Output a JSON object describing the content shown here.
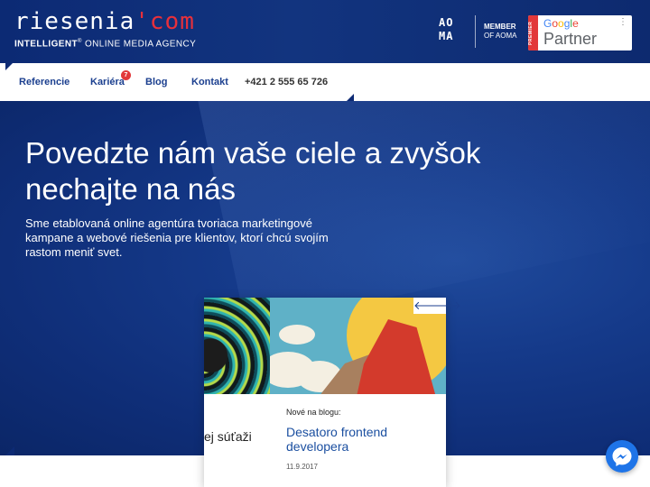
{
  "header": {
    "logo": {
      "word": "riesenia",
      "mark": "'",
      "suffix": "com",
      "tagline_bold": "INTELLIGENT",
      "tagline_sup": "®",
      "tagline_rest": " ONLINE MEDIA AGENCY"
    },
    "aoma": {
      "mark_line1": "AO",
      "mark_line2": "MA",
      "member": "MEMBER",
      "of": "OF AOMA"
    },
    "google_partner": {
      "premier": "PREMIER",
      "google": "Google",
      "partner": "Partner"
    }
  },
  "nav": {
    "items": [
      "Referencie",
      "Kariéra",
      "Blog",
      "Kontakt"
    ],
    "badge": "7",
    "phone": "+421 2 555 65 726"
  },
  "hero": {
    "title": "Povedzte nám vaše ciele a zvyšok nechajte na nás",
    "subtitle": "Sme etablovaná online agentúra tvoriaca marketingové kampane a webové riešenia pre klientov, ktorí chcú svojím rastom meniť svet."
  },
  "card": {
    "prev_arrow": "🡐",
    "next_arrow": "🡒",
    "left_text": "ej súťaži",
    "kicker": "Nové na blogu:",
    "headline": "Desatoro frontend developera",
    "date": "11.9.2017"
  },
  "colors": {
    "brand_blue": "#0c2a74",
    "accent_red": "#e2383a",
    "link_blue": "#1b4fa0",
    "messenger": "#1e74e8"
  }
}
